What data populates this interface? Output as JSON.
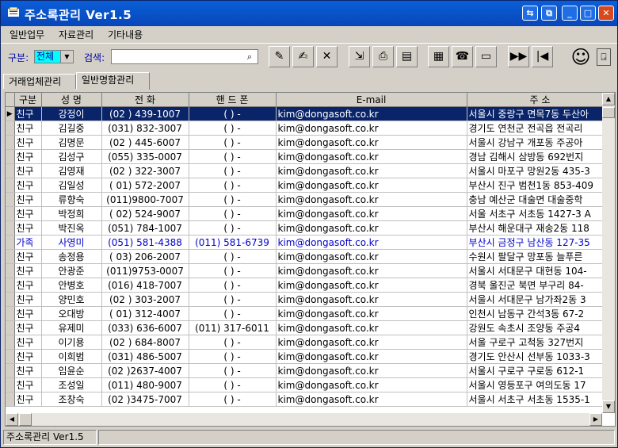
{
  "window": {
    "title": "주소록관리 Ver1.5"
  },
  "menu": [
    "일반업무",
    "자료관리",
    "기타내용"
  ],
  "toolbar": {
    "group_label": "구분:",
    "group_value": "전체",
    "search_label": "검색:",
    "search_value": ""
  },
  "tabs": [
    "거래업체관리",
    "일반명함관리"
  ],
  "grid": {
    "columns": [
      "구분",
      "성 명",
      "전 화",
      "핸 드 폰",
      "E-mail",
      "주 소"
    ],
    "rows": [
      {
        "type": "친구",
        "name": "강정이",
        "phone": "(02 ) 439-1007",
        "mobile": "(  )    -",
        "email": "kim@dongasoft.co.kr",
        "address": "서울시 중랑구 면목7동 두산아"
      },
      {
        "type": "친구",
        "name": "김길중",
        "phone": "(031) 832-3007",
        "mobile": "(  )    -",
        "email": "kim@dongasoft.co.kr",
        "address": "경기도 연천군 전곡읍 전곡리"
      },
      {
        "type": "친구",
        "name": "김명문",
        "phone": "(02 ) 445-6007",
        "mobile": "(  )    -",
        "email": "kim@dongasoft.co.kr",
        "address": "서울시 강남구 개포동 주공아"
      },
      {
        "type": "친구",
        "name": "김성구",
        "phone": "(055) 335-0007",
        "mobile": "(  )    -",
        "email": "kim@dongasoft.co.kr",
        "address": "경남 김해시 삼방동 692번지"
      },
      {
        "type": "친구",
        "name": "김영재",
        "phone": "(02 ) 322-3007",
        "mobile": "(  )    -",
        "email": "kim@dongasoft.co.kr",
        "address": "서울시 마포구 망원2동 435-3"
      },
      {
        "type": "친구",
        "name": "김일성",
        "phone": "( 01) 572-2007",
        "mobile": "(  )    -",
        "email": "kim@dongasoft.co.kr",
        "address": "부산시 진구 범천1동 853-409"
      },
      {
        "type": "친구",
        "name": "류향숙",
        "phone": "(011)9800-7007",
        "mobile": "(  )    -",
        "email": "kim@dongasoft.co.kr",
        "address": "충남 예산군 대술면 대술중학"
      },
      {
        "type": "친구",
        "name": "박정희",
        "phone": "( 02) 524-9007",
        "mobile": "(  )    -",
        "email": "kim@dongasoft.co.kr",
        "address": "서울 서초구 서초동 1427-3 A"
      },
      {
        "type": "친구",
        "name": "박진옥",
        "phone": "(051) 784-1007",
        "mobile": "(  )    -",
        "email": "kim@dongasoft.co.kr",
        "address": "부산시 해운대구 재송2동 118"
      },
      {
        "type": "가족",
        "name": "사영미",
        "phone": "(051) 581-4388",
        "mobile": "(011) 581-6739",
        "email": "kim@dongasoft.co.kr",
        "address": "부산시 금정구 남산동 127-35"
      },
      {
        "type": "친구",
        "name": "송정용",
        "phone": "( 03) 206-2007",
        "mobile": "(  )    -",
        "email": "kim@dongasoft.co.kr",
        "address": "수원시 팔달구 망포동 늘푸른"
      },
      {
        "type": "친구",
        "name": "안광준",
        "phone": "(011)9753-0007",
        "mobile": "(  )    -",
        "email": "kim@dongasoft.co.kr",
        "address": "서울시 서대문구 대현동 104-"
      },
      {
        "type": "친구",
        "name": "안병호",
        "phone": "(016) 418-7007",
        "mobile": "(  )    -",
        "email": "kim@dongasoft.co.kr",
        "address": "경북 울진군 북면 부구리 84-"
      },
      {
        "type": "친구",
        "name": "양민호",
        "phone": "(02 ) 303-2007",
        "mobile": "(  )    -",
        "email": "kim@dongasoft.co.kr",
        "address": "서울시 서대문구 남가좌2동 3"
      },
      {
        "type": "친구",
        "name": "오대방",
        "phone": "( 01) 312-4007",
        "mobile": "(  )    -",
        "email": "kim@dongasoft.co.kr",
        "address": "인천시 남동구 간석3동 67-2"
      },
      {
        "type": "친구",
        "name": "유제미",
        "phone": "(033) 636-6007",
        "mobile": "(011) 317-6011",
        "email": "kim@dongasoft.co.kr",
        "address": "강원도 속초시 조양동 주공4"
      },
      {
        "type": "친구",
        "name": "이기용",
        "phone": "(02 ) 684-8007",
        "mobile": "(  )    -",
        "email": "kim@dongasoft.co.kr",
        "address": "서울 구로구 고척동 327번지"
      },
      {
        "type": "친구",
        "name": "이희범",
        "phone": "(031) 486-5007",
        "mobile": "(  )    -",
        "email": "kim@dongasoft.co.kr",
        "address": "경기도 안산시 선부동 1033-3"
      },
      {
        "type": "친구",
        "name": "임윤순",
        "phone": "(02 )2637-4007",
        "mobile": "(  )    -",
        "email": "kim@dongasoft.co.kr",
        "address": "서울시 구로구 구로동 612-1"
      },
      {
        "type": "친구",
        "name": "조성일",
        "phone": "(011) 480-9007",
        "mobile": "(  )    -",
        "email": "kim@dongasoft.co.kr",
        "address": "서울시 영등포구 여의도동 17"
      },
      {
        "type": "친구",
        "name": "조창숙",
        "phone": "(02 )3475-7007",
        "mobile": "(  )    -",
        "email": "kim@dongasoft.co.kr",
        "address": "서울시 서초구 서초동 1535-1"
      }
    ]
  },
  "status": {
    "text": "주소록관리 Ver1.5"
  },
  "colors": {
    "title_bar": "#0a5fd9",
    "selection": "#0a246a",
    "combo_highlight": "#00ffff",
    "family_row": "#0000cc"
  },
  "icons": [
    "app-book-icon",
    "minimize-icon",
    "restore-icon",
    "close-icon",
    "pencil-icon",
    "edit-doc-icon",
    "delete-x-icon",
    "export-icon",
    "printer-icon",
    "print-preview-icon",
    "address-card-icon",
    "phone-book-icon",
    "computer-icon",
    "next-icon",
    "first-icon",
    "mascot-icon",
    "exit-door-icon"
  ]
}
